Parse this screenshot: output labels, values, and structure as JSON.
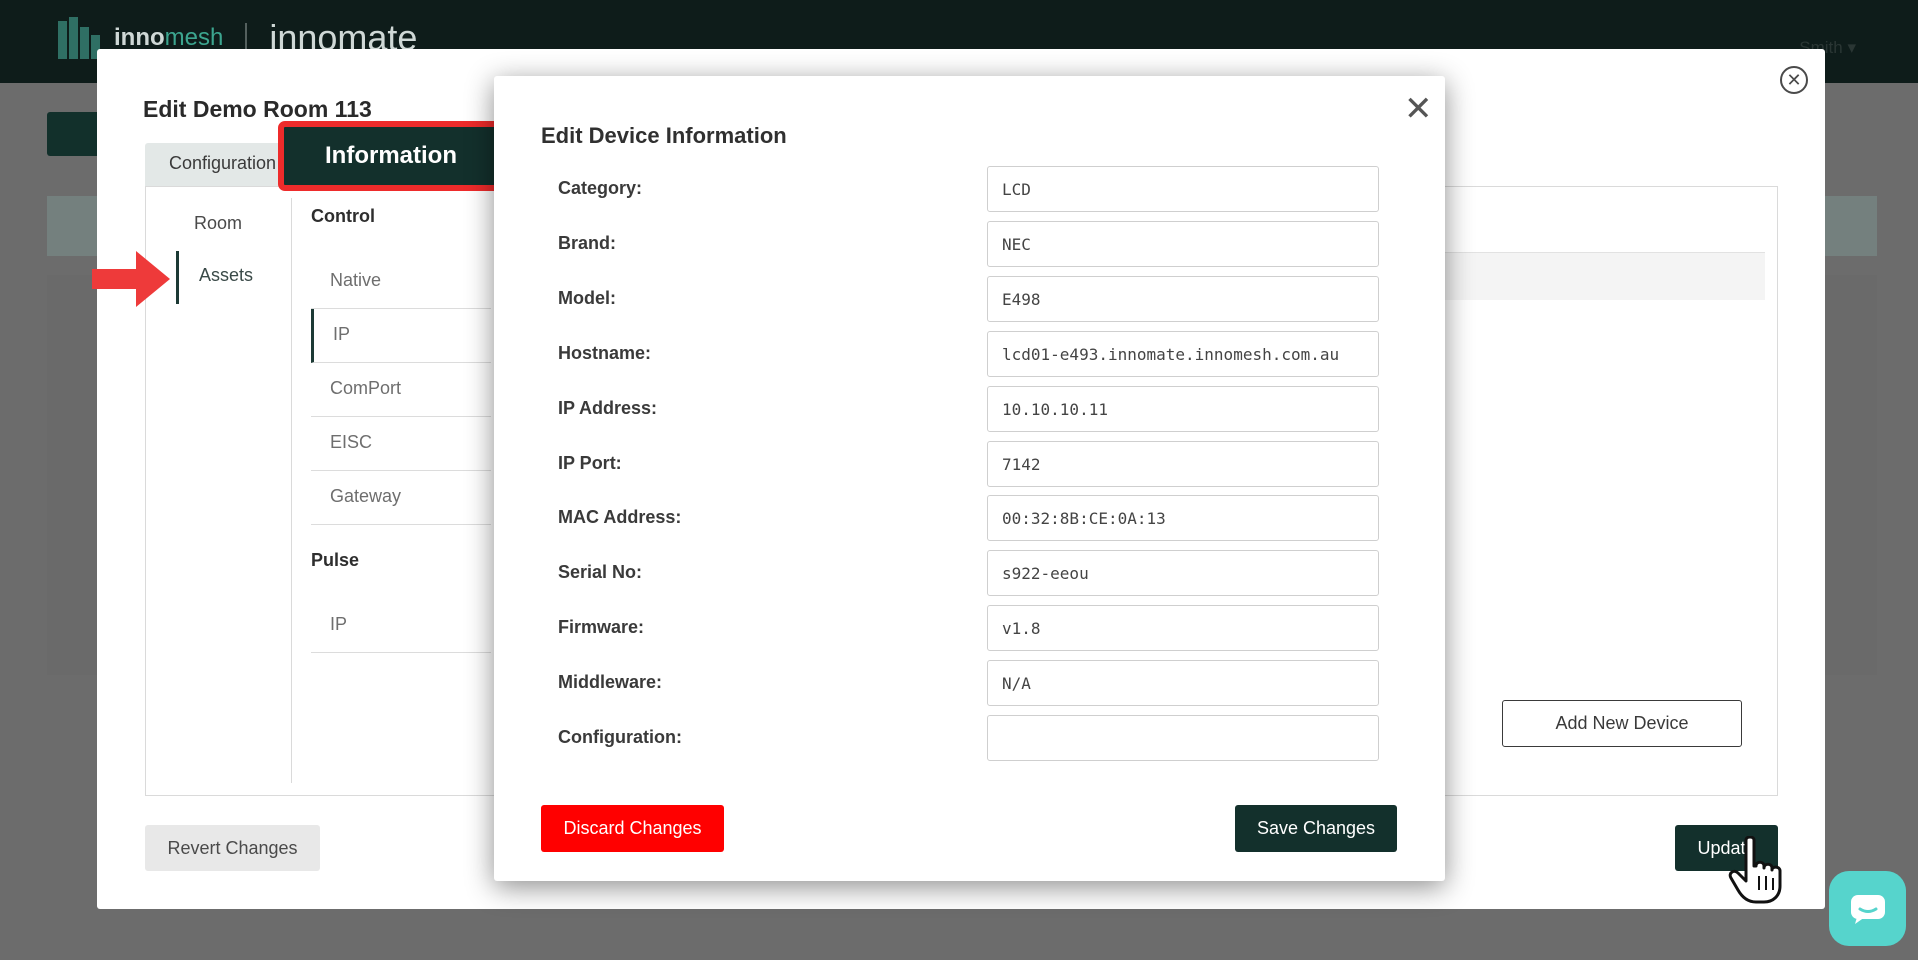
{
  "app": {
    "brand_prefix": "inno",
    "brand_suffix": "mesh",
    "brand_secondary": "innomate",
    "user_menu": "Smith ▾"
  },
  "outer_modal": {
    "title": "Edit Demo Room 113",
    "tabs": [
      {
        "label": "Configuration",
        "active": false
      },
      {
        "label": "Information",
        "active": true
      }
    ],
    "left_nav": [
      {
        "label": "Room",
        "active": false
      },
      {
        "label": "Assets",
        "active": true
      }
    ],
    "sections": [
      {
        "heading": "Control",
        "items": [
          "Native",
          "IP",
          "ComPort",
          "EISC",
          "Gateway"
        ],
        "active_item": "IP"
      },
      {
        "heading": "Pulse",
        "items": [
          "IP"
        ]
      }
    ],
    "add_device_label": "Add New Device",
    "revert_label": "Revert Changes",
    "update_label": "Update"
  },
  "device_modal": {
    "title": "Edit Device Information",
    "fields": [
      {
        "label": "Category:",
        "value": "LCD"
      },
      {
        "label": "Brand:",
        "value": "NEC"
      },
      {
        "label": "Model:",
        "value": "E498"
      },
      {
        "label": "Hostname:",
        "value": "lcd01-e493.innomate.innomesh.com.au"
      },
      {
        "label": "IP Address:",
        "value": "10.10.10.11"
      },
      {
        "label": "IP Port:",
        "value": "7142"
      },
      {
        "label": "MAC Address:",
        "value": "00:32:8B:CE:0A:13"
      },
      {
        "label": "Serial No:",
        "value": "s922-eeou"
      },
      {
        "label": "Firmware:",
        "value": "v1.8"
      },
      {
        "label": "Middleware:",
        "value": "N/A"
      },
      {
        "label": "Configuration:",
        "value": ""
      }
    ],
    "discard_label": "Discard Changes",
    "save_label": "Save Changes"
  },
  "colors": {
    "primary_dark": "#13302c",
    "discard_red": "#ff0000",
    "highlight_red": "#ee2b2b",
    "chat_teal": "#56d4cc"
  },
  "icons": {
    "outer_close": "circle-close-icon",
    "device_close": "close-icon",
    "arrow": "arrow-right-icon",
    "cursor": "hand-pointer-icon",
    "chat": "chat-icon"
  }
}
